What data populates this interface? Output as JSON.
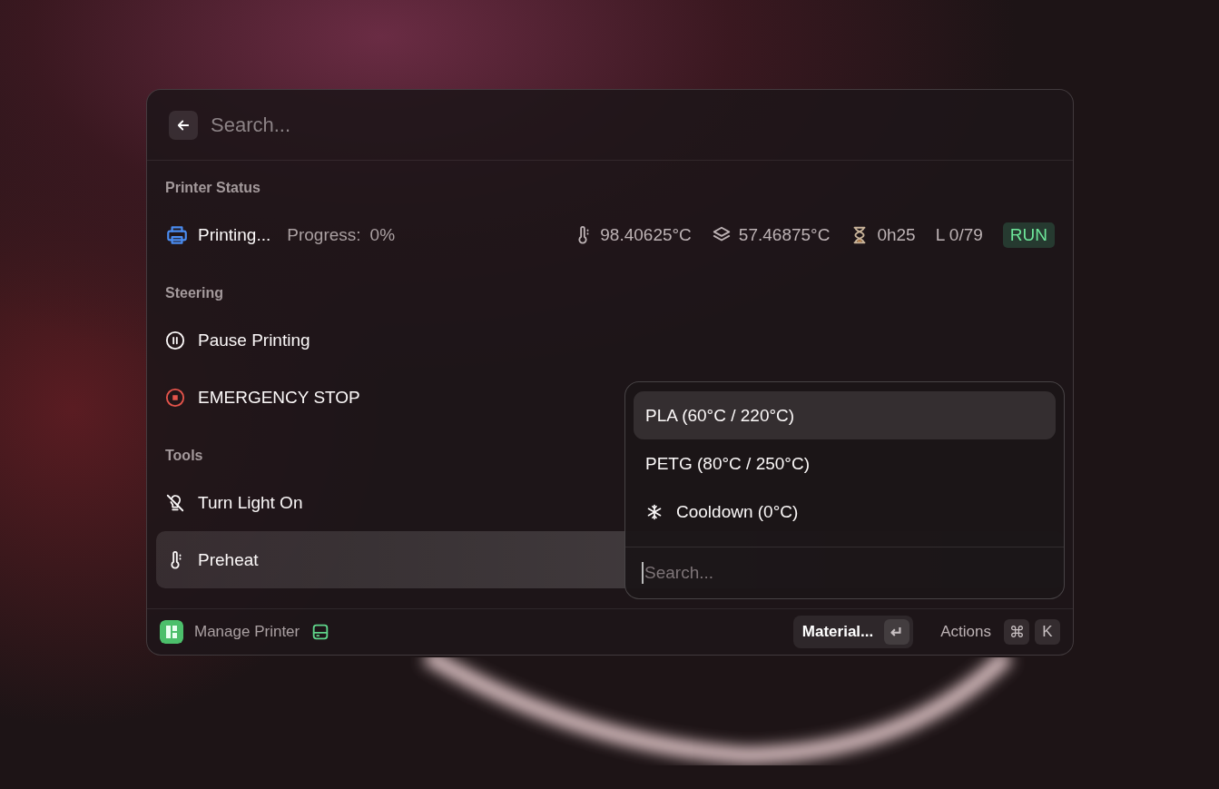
{
  "search": {
    "placeholder": "Search..."
  },
  "status_section": {
    "title": "Printer Status",
    "state": "Printing...",
    "progress_label": "Progress:",
    "progress_value": "0%",
    "nozzle_temp": "98.40625°C",
    "bed_temp": "57.46875°C",
    "time": "0h25",
    "layer": "L 0/79",
    "badge": "RUN"
  },
  "sections": [
    {
      "title": "Steering",
      "items": [
        {
          "label": "Pause Printing",
          "kind": "pause",
          "selected": false
        },
        {
          "label": "EMERGENCY STOP",
          "kind": "stop",
          "selected": false
        }
      ]
    },
    {
      "title": "Tools",
      "items": [
        {
          "label": "Turn Light On",
          "kind": "light-off",
          "selected": false
        },
        {
          "label": "Preheat",
          "kind": "thermometer",
          "selected": true
        }
      ]
    }
  ],
  "dropdown": {
    "options": [
      {
        "label": "PLA (60°C / 220°C)",
        "selected": true
      },
      {
        "label": "PETG (80°C / 250°C)",
        "selected": false
      },
      {
        "label": "Cooldown (0°C)",
        "kind": "snowflake",
        "selected": false
      }
    ],
    "search": {
      "placeholder": "Search..."
    }
  },
  "footer": {
    "title": "Manage Printer",
    "primary_action": {
      "label": "Material...",
      "key": "↵"
    },
    "actions": {
      "label": "Actions",
      "keys": [
        "⌘",
        "K"
      ]
    }
  }
}
